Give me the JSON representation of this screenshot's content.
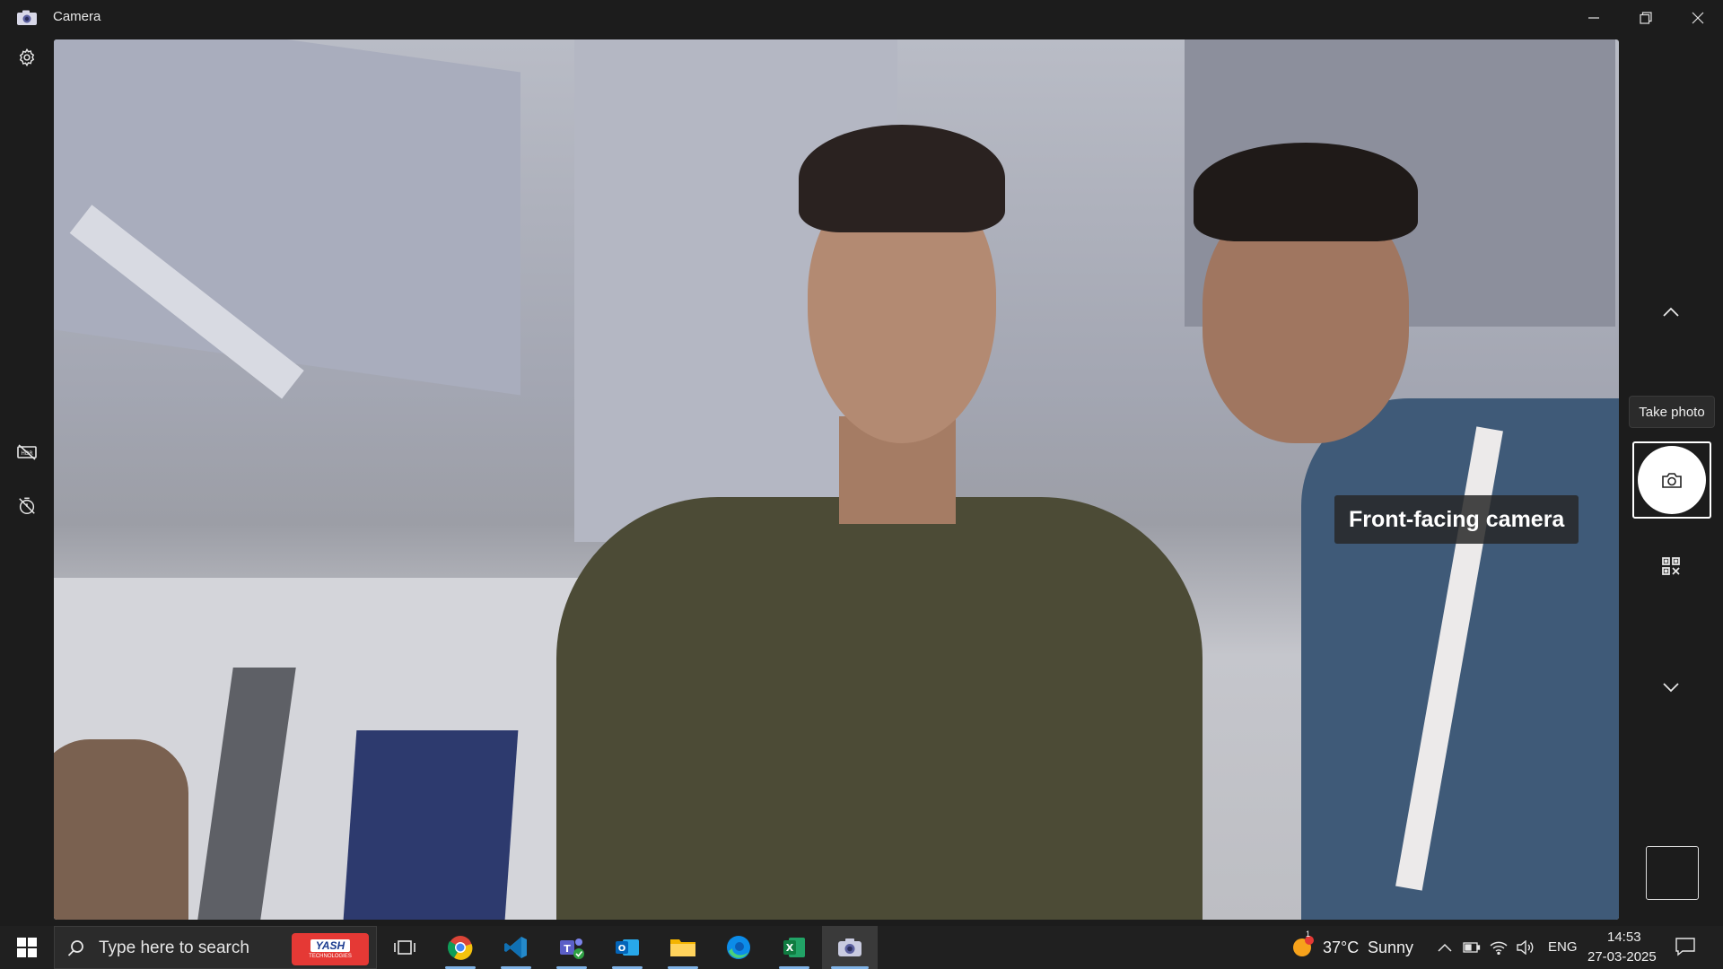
{
  "window": {
    "title": "Camera"
  },
  "viewfinder": {
    "camera_label": "Front-facing camera"
  },
  "right_rail": {
    "tooltip": "Take photo",
    "mode_up": "chevron-up-icon",
    "mode_down": "chevron-down-icon",
    "shutter": "camera-icon",
    "qr": "qr-code-icon"
  },
  "left_rail": {
    "items": [
      "gear-icon",
      "hdr-off-icon",
      "timer-off-icon"
    ]
  },
  "taskbar": {
    "search_placeholder": "Type here to search",
    "promo_logo": "YASH",
    "promo_sub": "TECHNOLOGIES",
    "apps": [
      {
        "name": "Google Chrome",
        "icon": "chrome-icon"
      },
      {
        "name": "Visual Studio Code",
        "icon": "vscode-icon"
      },
      {
        "name": "Microsoft Teams",
        "icon": "teams-icon"
      },
      {
        "name": "Outlook",
        "icon": "outlook-icon"
      },
      {
        "name": "File Explorer",
        "icon": "folder-icon"
      },
      {
        "name": "Microsoft Edge",
        "icon": "edge-icon"
      },
      {
        "name": "Excel",
        "icon": "excel-icon"
      },
      {
        "name": "Camera",
        "icon": "camera-icon"
      }
    ],
    "weather": {
      "temp": "37°C",
      "condition": "Sunny",
      "alert_count": "1"
    },
    "language": "ENG",
    "time": "14:53",
    "date": "27-03-2025"
  },
  "colors": {
    "titlebar_bg": "#1c1c1c",
    "taskbar_bg": "#202020",
    "accent_underline": "#7fb2e5",
    "promo_bg": "#e53935"
  }
}
